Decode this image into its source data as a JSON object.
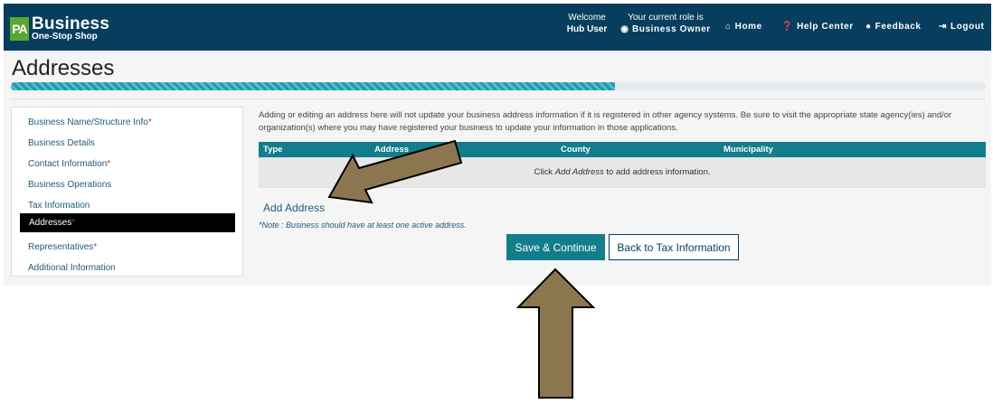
{
  "header": {
    "logo_badge": "PA",
    "logo_title": "Business",
    "logo_subtitle": "One-Stop Shop",
    "welcome_label": "Welcome",
    "welcome_user": "Hub User",
    "role_label": "Your current role is",
    "role_value": "Business Owner",
    "nav": [
      {
        "label": "Home",
        "icon": "home-icon"
      },
      {
        "label": "Help Center",
        "icon": "question-circle-icon"
      },
      {
        "label": "Feedback",
        "icon": "speech-bubble-icon"
      },
      {
        "label": "Logout",
        "icon": "logout-icon"
      }
    ]
  },
  "page": {
    "title": "Addresses",
    "progress_percent": 62
  },
  "sidebar": {
    "items": [
      {
        "label": "Business Name/Structure Info",
        "required": "*"
      },
      {
        "label": "Business Details",
        "required": ""
      },
      {
        "label": "Contact Information",
        "required": "*"
      },
      {
        "label": "Business Operations",
        "required": ""
      },
      {
        "label": "Tax Information",
        "required": ""
      },
      {
        "label": "Addresses",
        "required": "*",
        "active": true
      },
      {
        "label": "Representatives",
        "required": "*"
      },
      {
        "label": "Additional Information",
        "required": ""
      }
    ]
  },
  "main": {
    "info_text": "Adding or editing an address here will not update your business address information if it is registered in other agency systems. Be sure to visit the appropriate state agency(ies) and/or organization(s) where you may have registered your business to update your information in those applications.",
    "table": {
      "columns": [
        "Type",
        "Address",
        "County",
        "Municipality"
      ],
      "empty_prefix": "Click ",
      "empty_link": "Add Address",
      "empty_suffix": " to add address information."
    },
    "add_address_label": "Add Address",
    "note": "*Note : Business should have at least one active address.",
    "save_button": "Save & Continue",
    "back_button": "Back to Tax Information"
  },
  "colors": {
    "header_bg": "#073e5e",
    "accent_teal": "#127e8c",
    "logo_green": "#5aa832",
    "annotation_arrow": "#8c7650"
  }
}
